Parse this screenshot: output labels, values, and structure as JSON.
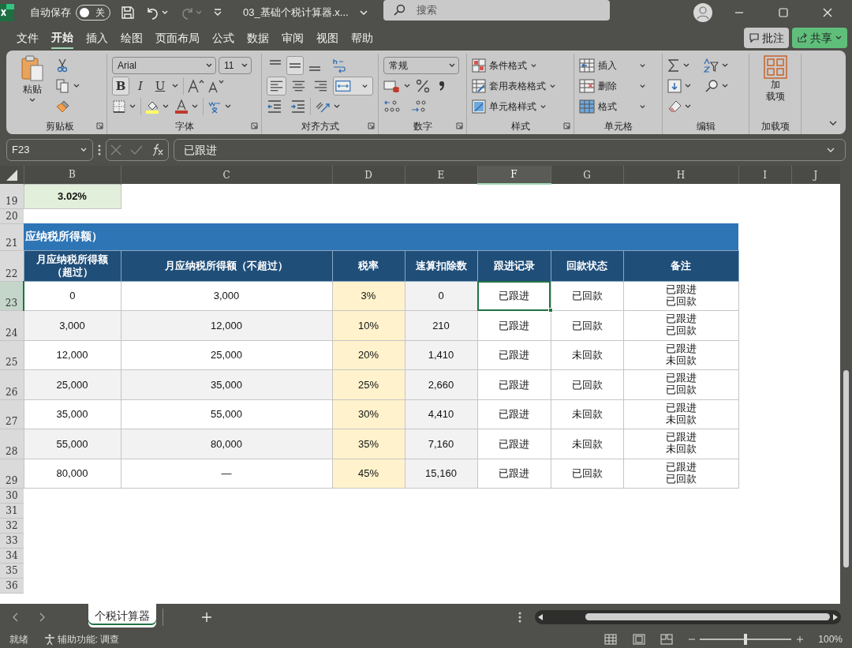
{
  "title_bar": {
    "autosave_label": "自动保存",
    "autosave_toggle": "关",
    "autosave_on": false,
    "filename": "03_基础个税计算器.x...",
    "search_placeholder": "搜索"
  },
  "menu_tabs": [
    {
      "label": "文件",
      "selected": false
    },
    {
      "label": "开始",
      "selected": true
    },
    {
      "label": "插入",
      "selected": false
    },
    {
      "label": "绘图",
      "selected": false
    },
    {
      "label": "页面布局",
      "selected": false
    },
    {
      "label": "公式",
      "selected": false
    },
    {
      "label": "数据",
      "selected": false
    },
    {
      "label": "审阅",
      "selected": false
    },
    {
      "label": "视图",
      "selected": false
    },
    {
      "label": "帮助",
      "selected": false
    }
  ],
  "header_buttons": {
    "comments": "批注",
    "share": "共享"
  },
  "ribbon": {
    "clipboard": {
      "paste": "粘贴",
      "label": "剪贴板"
    },
    "font": {
      "family": "Arial",
      "size": "11",
      "bold": "B",
      "italic": "I",
      "underline": "U",
      "bold_on": true,
      "label": "字体"
    },
    "alignment": {
      "vertical": [
        {
          "kind": "top",
          "selected": false
        },
        {
          "kind": "middle",
          "selected": true
        },
        {
          "kind": "bottom",
          "selected": false
        }
      ],
      "horizontal": [
        {
          "kind": "left",
          "selected": true
        },
        {
          "kind": "center",
          "selected": false
        },
        {
          "kind": "right",
          "selected": false
        }
      ],
      "merge_on": true,
      "label": "对齐方式"
    },
    "number": {
      "format": "常规",
      "label": "数字"
    },
    "styles": {
      "items": [
        "条件格式",
        "套用表格格式",
        "单元格样式"
      ],
      "label": "样式"
    },
    "cells": {
      "items": [
        "插入",
        "删除",
        "格式"
      ],
      "label": "单元格"
    },
    "editing": {
      "label": "编辑"
    },
    "addins": {
      "button_lines": [
        "加",
        "载项"
      ],
      "label": "加载项"
    }
  },
  "formula_bar": {
    "name_box": "F23",
    "formula": "已跟进"
  },
  "columns": [
    {
      "letter": "B",
      "selected": false
    },
    {
      "letter": "C",
      "selected": false
    },
    {
      "letter": "D",
      "selected": false
    },
    {
      "letter": "E",
      "selected": false
    },
    {
      "letter": "F",
      "selected": true
    },
    {
      "letter": "G",
      "selected": false
    },
    {
      "letter": "H",
      "selected": false
    },
    {
      "letter": "I",
      "selected": false
    },
    {
      "letter": "J",
      "selected": false
    }
  ],
  "rows": [
    {
      "number": "19",
      "kind": "value",
      "selected": false,
      "cells": [
        "3.02%"
      ]
    },
    {
      "number": "20",
      "kind": "blank",
      "selected": false
    },
    {
      "number": "21",
      "kind": "band",
      "selected": false,
      "text": "应纳税所得额）"
    },
    {
      "number": "22",
      "kind": "header",
      "selected": false,
      "cells": [
        "月应纳税所得额（超过）",
        "月应纳税所得额（不超过）",
        "税率",
        "速算扣除数",
        "跟进记录",
        "回款状态",
        "备注"
      ]
    },
    {
      "number": "23",
      "kind": "data",
      "selected": true,
      "shaded": false,
      "cells": [
        "0",
        "3,000",
        "3%",
        "0",
        "已跟进",
        "已回款"
      ],
      "note": [
        "已跟进",
        "已回款"
      ]
    },
    {
      "number": "24",
      "kind": "data",
      "selected": false,
      "shaded": true,
      "cells": [
        "3,000",
        "12,000",
        "10%",
        "210",
        "已跟进",
        "已回款"
      ],
      "note": [
        "已跟进",
        "已回款"
      ]
    },
    {
      "number": "25",
      "kind": "data",
      "selected": false,
      "shaded": false,
      "cells": [
        "12,000",
        "25,000",
        "20%",
        "1,410",
        "已跟进",
        "未回款"
      ],
      "note": [
        "已跟进",
        "未回款"
      ]
    },
    {
      "number": "26",
      "kind": "data",
      "selected": false,
      "shaded": true,
      "cells": [
        "25,000",
        "35,000",
        "25%",
        "2,660",
        "已跟进",
        "已回款"
      ],
      "note": [
        "已跟进",
        "已回款"
      ]
    },
    {
      "number": "27",
      "kind": "data",
      "selected": false,
      "shaded": false,
      "cells": [
        "35,000",
        "55,000",
        "30%",
        "4,410",
        "已跟进",
        "未回款"
      ],
      "note": [
        "已跟进",
        "未回款"
      ]
    },
    {
      "number": "28",
      "kind": "data",
      "selected": false,
      "shaded": true,
      "cells": [
        "55,000",
        "80,000",
        "35%",
        "7,160",
        "已跟进",
        "未回款"
      ],
      "note": [
        "已跟进",
        "未回款"
      ]
    },
    {
      "number": "29",
      "kind": "data",
      "selected": false,
      "shaded": false,
      "cells": [
        "80,000",
        "—",
        "45%",
        "15,160",
        "已跟进",
        "已回款"
      ],
      "note": [
        "已跟进",
        "已回款"
      ]
    },
    {
      "number": "30",
      "kind": "blank",
      "selected": false
    },
    {
      "number": "31",
      "kind": "blank",
      "selected": false
    },
    {
      "number": "32",
      "kind": "blank",
      "selected": false
    },
    {
      "number": "33",
      "kind": "blank",
      "selected": false
    },
    {
      "number": "34",
      "kind": "blank",
      "selected": false
    },
    {
      "number": "35",
      "kind": "blank",
      "selected": false
    },
    {
      "number": "36",
      "kind": "blank",
      "selected": false
    }
  ],
  "sheet_tabs": [
    {
      "label": "个税计算器",
      "selected": true
    }
  ],
  "status_bar": {
    "ready": "就绪",
    "accessibility": "辅助功能: 调查",
    "zoom_slider": {
      "level": 0.5
    },
    "zoom": "100%"
  }
}
